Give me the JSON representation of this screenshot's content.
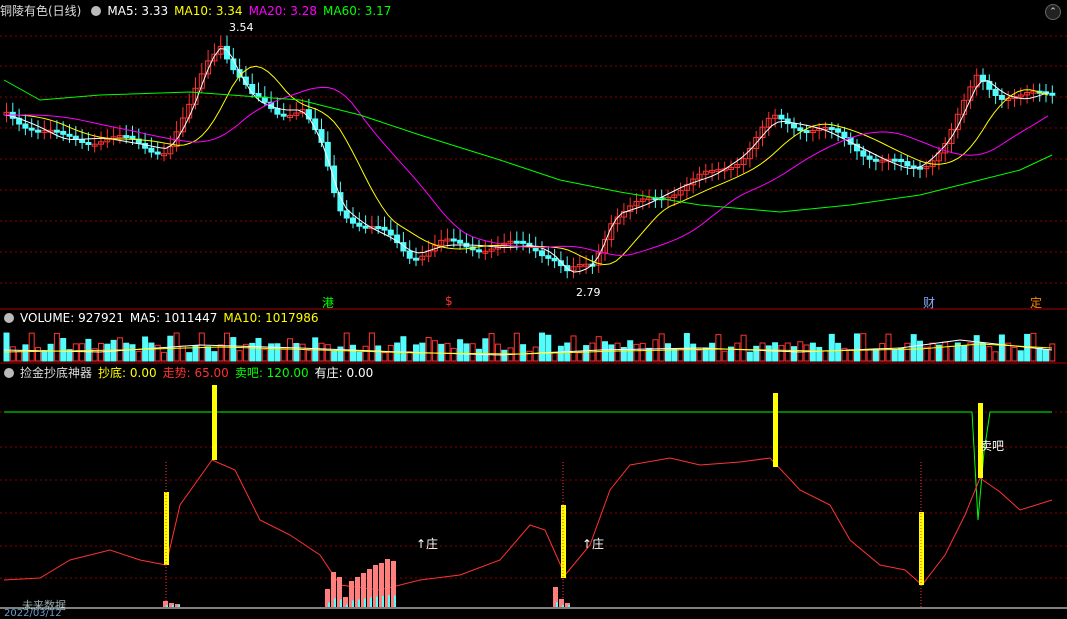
{
  "main_panel": {
    "title": "铜陵有色(日线)",
    "ma_labels": [
      {
        "label": "MA5: 3.33",
        "color": "#ffffff"
      },
      {
        "label": "MA10: 3.34",
        "color": "#ffff00"
      },
      {
        "label": "MA20: 3.28",
        "color": "#ff00ff"
      },
      {
        "label": "MA60: 3.17",
        "color": "#00ff00"
      }
    ],
    "high_label": "3.54",
    "low_label": "2.79",
    "event_markers": [
      {
        "text": "港",
        "color": "#00ff00"
      },
      {
        "text": "$",
        "color": "#ff3030"
      },
      {
        "text": "财",
        "color": "#88aaff"
      },
      {
        "text": "定",
        "color": "#ff8800"
      }
    ],
    "corner_button": "⌃"
  },
  "volume_panel": {
    "labels": [
      {
        "label": "VOLUME: 927921",
        "color": "#ffffff"
      },
      {
        "label": "MA5: 1011447",
        "color": "#ffffff"
      },
      {
        "label": "MA10: 1017986",
        "color": "#ffff00"
      }
    ]
  },
  "indicator_panel": {
    "title": "捡金抄底神器",
    "labels": [
      {
        "label": "抄底: 0.00",
        "color": "#ffff00",
        "key": "抄底"
      },
      {
        "label": "走势: 65.00",
        "color": "#ff3030",
        "key": "走势"
      },
      {
        "label": "卖吧: 120.00",
        "color": "#00ff00",
        "key": "卖吧"
      },
      {
        "label": "有庄: 0.00",
        "color": "#ffffff",
        "key": "有庄"
      }
    ],
    "signals": [
      {
        "text": "↑庄",
        "color": "#ffffff"
      },
      {
        "text": "↑庄",
        "color": "#ffffff"
      },
      {
        "text": "卖吧",
        "color": "#ffffff"
      }
    ],
    "footer_text": "未来数据",
    "date_text": "2022/03/12"
  },
  "colors": {
    "up": "#ff3232",
    "down": "#54fcfc",
    "ma5": "#ffffff",
    "ma10": "#ffff00",
    "ma20": "#ff00ff",
    "ma60": "#00ff00",
    "grid": "#8b0000",
    "sep": "#b00000"
  }
}
